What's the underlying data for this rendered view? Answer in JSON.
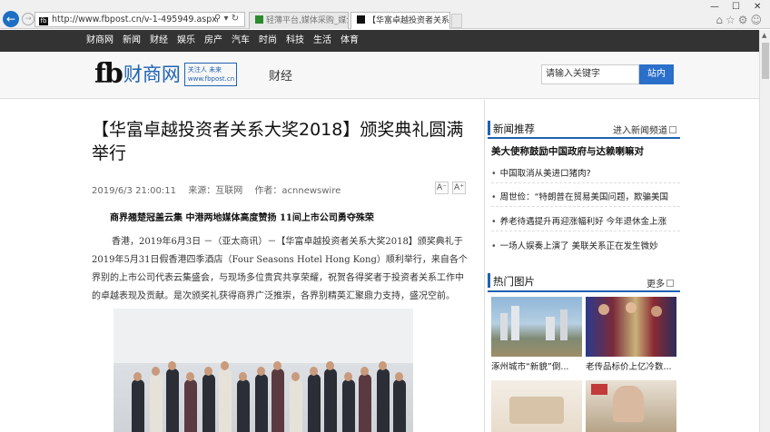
{
  "browser": {
    "url": "http://www.fbpost.cn/v-1-495949.aspx",
    "tabs": [
      {
        "label": "轻薄平台,媒体采购_媒介..."
      },
      {
        "label": "【华富卓越投资者关系大奖..."
      }
    ]
  },
  "nav": {
    "items": [
      "财商网",
      "新闻",
      "财经",
      "娱乐",
      "房产",
      "汽车",
      "时尚",
      "科技",
      "生活",
      "体育"
    ]
  },
  "header": {
    "logo_fb": "fb",
    "logo_name": "财商网",
    "slogan_line1": "关注人 未来",
    "slogan_line2": "www.fbpost.cn",
    "channel": "财经",
    "search_placeholder": "请输入关键字",
    "search_button": "站内"
  },
  "article": {
    "title": "【华富卓越投资者关系大奖2018】颁奖典礼圆满举行",
    "date": "2019/6/3 21:00:11",
    "source": "来源：互联网",
    "author": "作者：acnnewswire",
    "font_small": "A⁻",
    "font_large": "A⁺",
    "subhead": "商界翘楚冠盖云集 中港两地媒体高度赞扬 11间上市公司勇夺殊荣",
    "body": "香港，2019年6月3日 －（亚太商讯）－【华富卓越投资者关系大奖2018】颁奖典礼于2019年5月31日假香港四季酒店（Four Seasons Hotel Hong Kong）顺利举行，来自各个界别的上市公司代表云集盛会，与现场多位贵宾共享荣耀，祝贺各得奖者于投资者关系工作中的卓越表现及贡献。是次颁奖礼获得商界广泛推崇，各界别精英汇聚鼎力支持，盛况空前。"
  },
  "sidebar": {
    "news_title": "新闻推荐",
    "news_more": "进入新闻频道",
    "headline": "美大使称鼓励中国政府与达赖喇嘛对",
    "news_items": [
      "中国取消从美进口猪肉?",
      "周世俭：“特朗普在贸易美国问题，欺骗美国",
      "养老待遇提升再迎涨幅利好 今年退休金上涨",
      "一场人娱奏上演了 美联关系正在发生微妙"
    ],
    "pics_title": "热门图片",
    "pics_more": "更多",
    "pics": [
      {
        "caption": "涿州城市“新貌”倒..."
      },
      {
        "caption": "老传品标价上亿冷数..."
      }
    ]
  }
}
